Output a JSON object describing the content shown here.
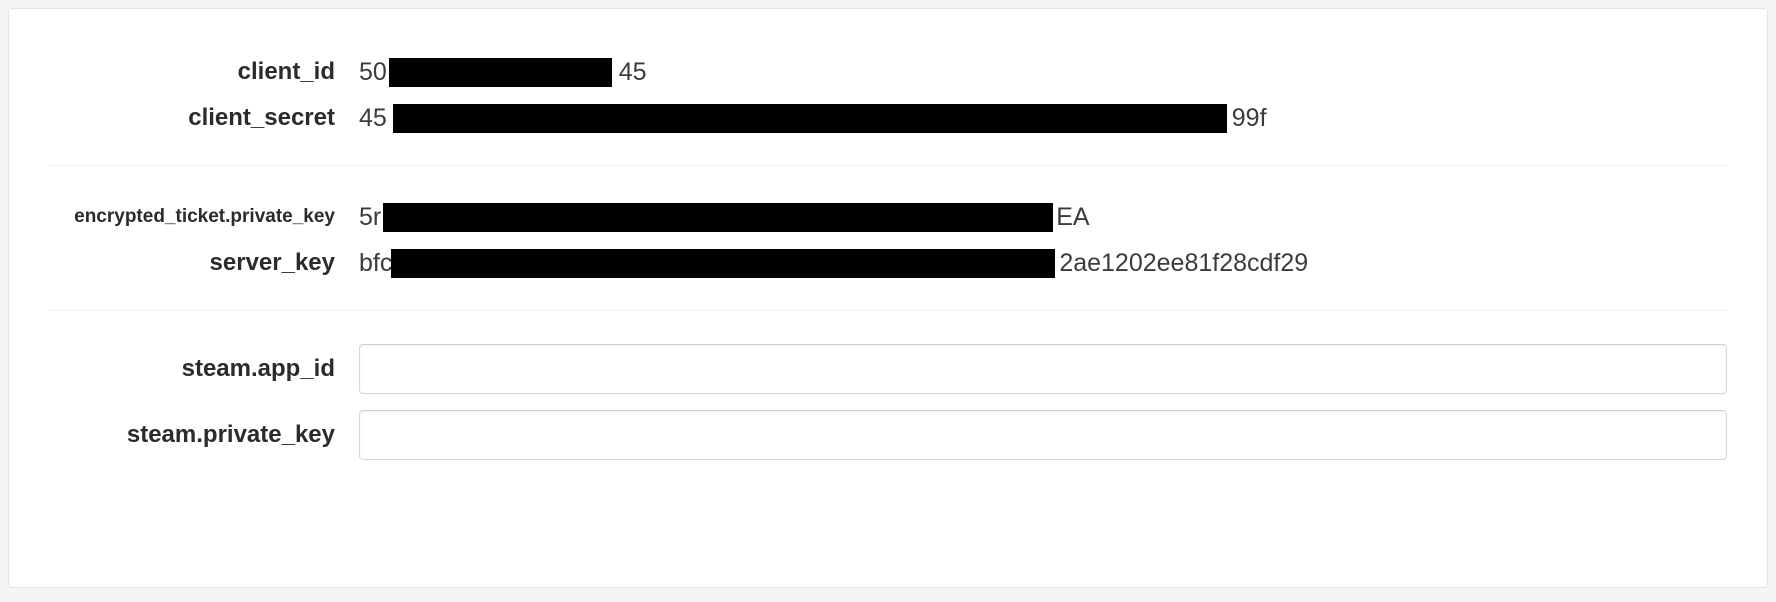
{
  "section1": {
    "client_id": {
      "label": "client_id",
      "value_prefix": "50",
      "value_suffix": "45"
    },
    "client_secret": {
      "label": "client_secret",
      "value_prefix": "45",
      "value_suffix": "99f"
    }
  },
  "section2": {
    "encrypted_ticket_private_key": {
      "label": "encrypted_ticket.private_key",
      "value_prefix": "5r",
      "value_suffix": "EA"
    },
    "server_key": {
      "label": "server_key",
      "value_prefix": "bfc",
      "value_suffix": "2ae1202ee81f28cdf29"
    }
  },
  "section3": {
    "steam_app_id": {
      "label": "steam.app_id",
      "value": ""
    },
    "steam_private_key": {
      "label": "steam.private_key",
      "value": ""
    }
  }
}
